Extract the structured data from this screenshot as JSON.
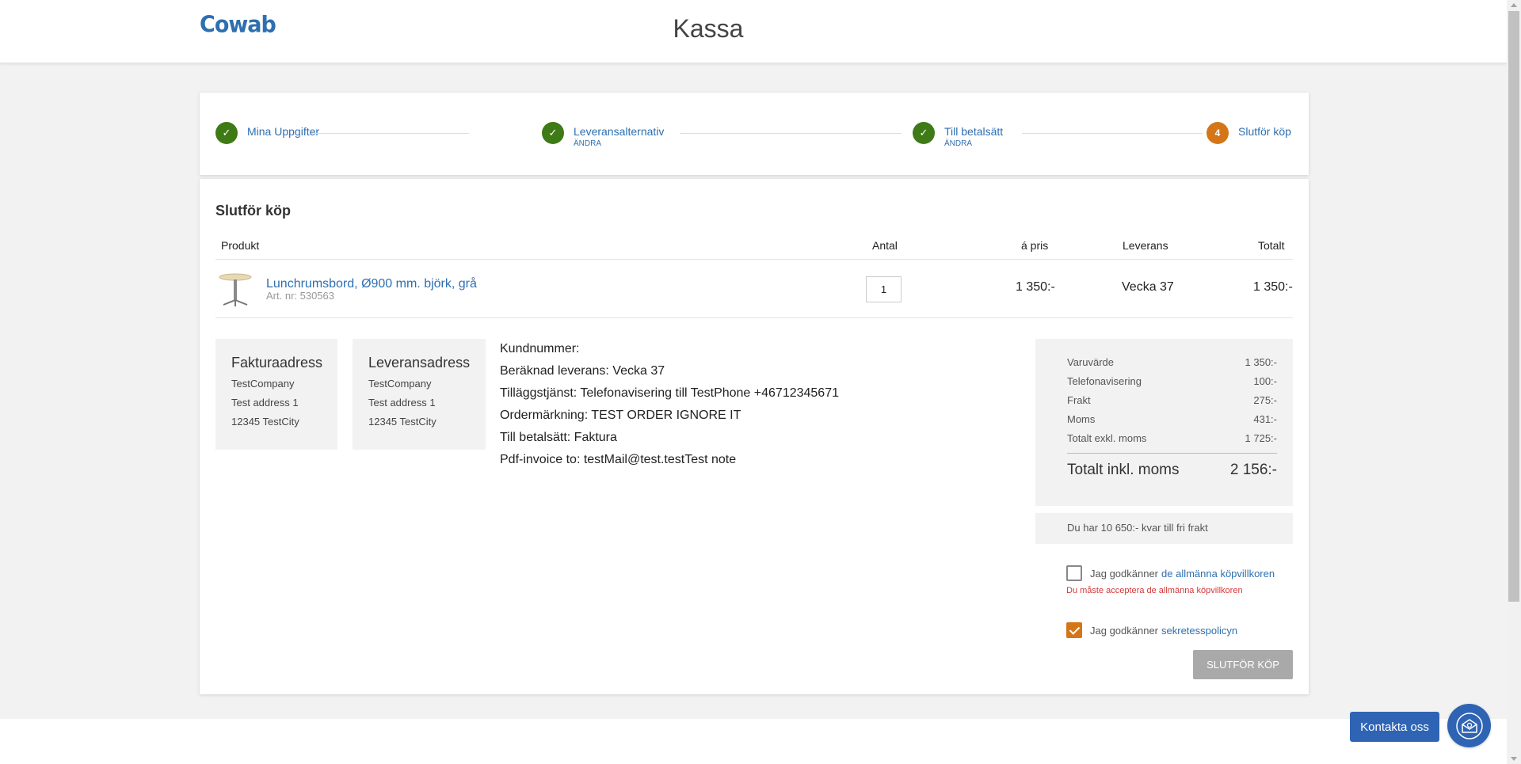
{
  "header": {
    "logo": "Cowab",
    "title": "Kassa"
  },
  "steps": [
    {
      "label": "Mina Uppgifter",
      "sub": "",
      "status": "done"
    },
    {
      "label": "Leveransalternativ",
      "sub": "ÄNDRA",
      "status": "done"
    },
    {
      "label": "Till betalsätt",
      "sub": "ÄNDRA",
      "status": "done"
    },
    {
      "label": "Slutför köp",
      "sub": "",
      "status": "current",
      "number": "4"
    }
  ],
  "main": {
    "section_title": "Slutför köp",
    "columns": {
      "product": "Produkt",
      "qty": "Antal",
      "price": "á pris",
      "delivery": "Leverans",
      "total": "Totalt"
    },
    "product": {
      "name": "Lunchrumsbord, Ø900 mm. björk, grå",
      "art": "Art. nr: 530563",
      "qty": "1",
      "price": "1 350:-",
      "delivery": "Vecka 37",
      "total": "1 350:-"
    },
    "billing": {
      "title": "Fakturaadress",
      "company": "TestCompany",
      "address": "Test address 1",
      "city": "12345 TestCity"
    },
    "shipping": {
      "title": "Leveransadress",
      "company": "TestCompany",
      "address": "Test address 1",
      "city": "12345 TestCity"
    },
    "info": [
      "Kundnummer:",
      "Beräknad leverans: Vecka 37",
      "Tilläggstjänst: Telefonavisering till TestPhone +46712345671",
      "Ordermärkning: TEST ORDER IGNORE IT",
      "Till betalsätt: Faktura",
      "Pdf-invoice to: testMail@test.testTest note"
    ],
    "summary": {
      "rows": [
        {
          "label": "Varuvärde",
          "value": "1 350:-"
        },
        {
          "label": "Telefonavisering",
          "value": "100:-"
        },
        {
          "label": "Frakt",
          "value": "275:-"
        },
        {
          "label": "Moms",
          "value": "431:-"
        },
        {
          "label": "Totalt exkl. moms",
          "value": "1 725:-"
        }
      ],
      "total_label": "Totalt inkl. moms",
      "total_value": "2 156:-"
    },
    "free_shipping": "Du har 10 650:- kvar till fri frakt",
    "terms": {
      "prefix": "Jag godkänner",
      "link": "de allmänna köpvillkoren",
      "checked": false,
      "error": "Du måste acceptera de allmänna köpvillkoren"
    },
    "privacy": {
      "prefix": "Jag godkänner",
      "link": "sekretesspolicyn",
      "checked": true
    },
    "submit_label": "Slutför köp"
  },
  "contact": {
    "label": "Kontakta oss",
    "icon": "mail-icon"
  },
  "colors": {
    "brand_blue": "#2e6fb0",
    "step_done": "#3e7a16",
    "step_current": "#d47618",
    "error": "#d23a3a"
  }
}
